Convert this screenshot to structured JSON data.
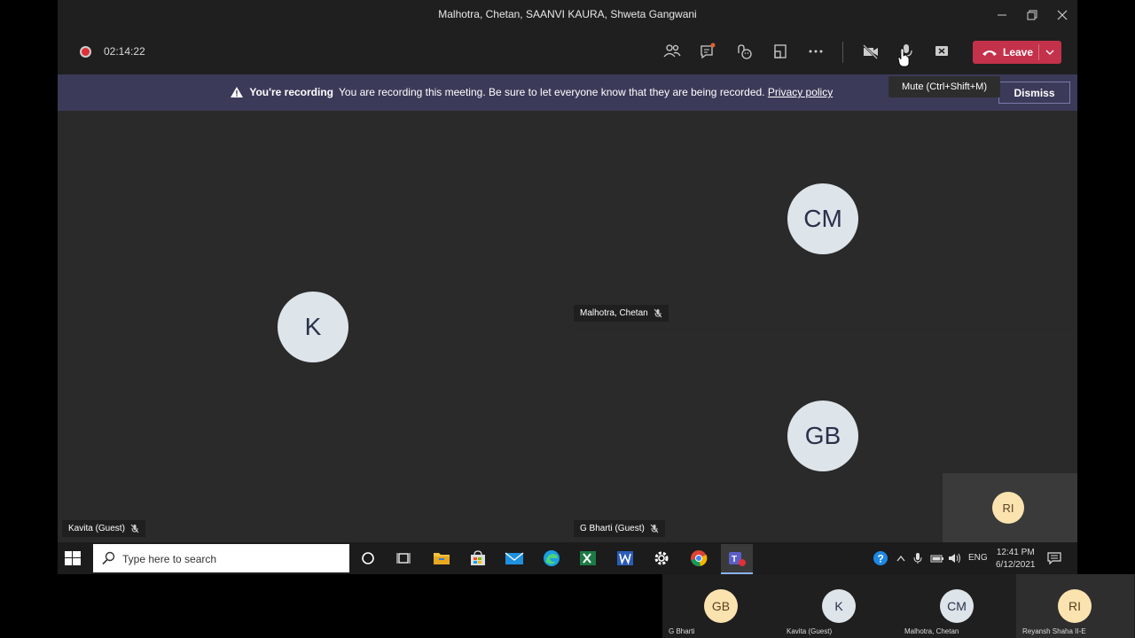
{
  "window": {
    "title": "Malhotra, Chetan, SAANVI KAURA, Shweta Gangwani"
  },
  "toolbar": {
    "timer": "02:14:22",
    "leave_label": "Leave",
    "icons": [
      "participants-icon",
      "chat-icon",
      "reactions-icon",
      "rooms-icon",
      "more-icon",
      "camera-off-icon",
      "mic-icon",
      "share-icon"
    ]
  },
  "banner": {
    "title": "You're recording",
    "message": "You are recording this meeting. Be sure to let everyone know that they are being recorded.",
    "link": "Privacy policy",
    "dismiss": "Dismiss"
  },
  "tooltip": {
    "text": "Mute (Ctrl+Shift+M)"
  },
  "participants": {
    "kavita": {
      "initials": "K",
      "name": "Kavita (Guest)"
    },
    "chetan": {
      "initials": "CM",
      "name": "Malhotra, Chetan"
    },
    "gbharti": {
      "initials": "GB",
      "name": "G Bharti (Guest)"
    },
    "self": {
      "initials": "RI"
    }
  },
  "taskbar": {
    "search_placeholder": "Type here to search",
    "lang": "ENG",
    "time": "12:41 PM",
    "date": "6/12/2021"
  },
  "strip": [
    {
      "initials": "GB",
      "name": "G Bharti",
      "bg": "#fbe3b0",
      "fg": "#5a4020"
    },
    {
      "initials": "K",
      "name": "Kavita (Guest)",
      "bg": "#dde4ea",
      "fg": "#29324a"
    },
    {
      "initials": "CM",
      "name": "Malhotra, Chetan",
      "bg": "#dde4ea",
      "fg": "#29324a"
    },
    {
      "initials": "RI",
      "name": "Reyansh Shaha II-E",
      "bg": "#fbe3b0",
      "fg": "#5a4020"
    }
  ],
  "colors": {
    "leave": "#c4314b",
    "banner": "#3b3a59",
    "stage": "#2a2a2a"
  }
}
